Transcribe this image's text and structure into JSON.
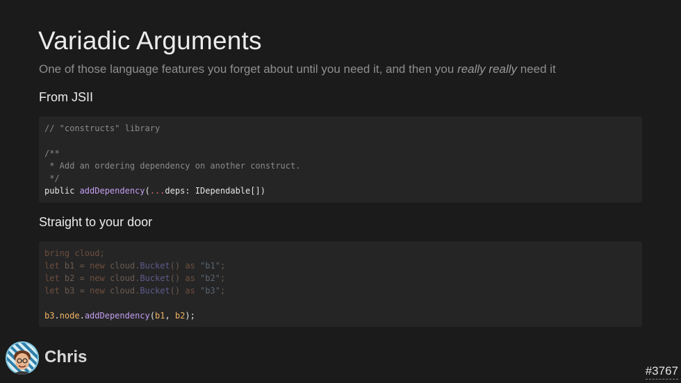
{
  "slide": {
    "title": "Variadic Arguments",
    "subtitle_prefix": "One of those language features you forget about until you need it, and then you ",
    "subtitle_emphasis": "really really",
    "subtitle_suffix": " need it"
  },
  "section1": {
    "heading": "From JSII",
    "code": {
      "line1": "// \"constructs\" library",
      "line3": "/**",
      "line4": " * Add an ordering dependency on another construct.",
      "line5": " */",
      "line6_public": "public ",
      "line6_fn": "addDependency",
      "line6_paren": "(",
      "line6_spread": "...",
      "line6_rest": "deps: IDependable[])"
    }
  },
  "section2": {
    "heading": "Straight to your door",
    "code": {
      "line1_kw": "bring",
      "line1_rest": " cloud;",
      "lines": [
        {
          "let": "let",
          "var": " b1 = ",
          "new": "new",
          "mod": " cloud.",
          "cls": "Bucket",
          "call": "() ",
          "as": "as",
          "str": " \"b1\"",
          "end": ";"
        },
        {
          "let": "let",
          "var": " b2 = ",
          "new": "new",
          "mod": " cloud.",
          "cls": "Bucket",
          "call": "() ",
          "as": "as",
          "str": " \"b2\"",
          "end": ";"
        },
        {
          "let": "let",
          "var": " b3 = ",
          "new": "new",
          "mod": " cloud.",
          "cls": "Bucket",
          "call": "() ",
          "as": "as",
          "str": " \"b3\"",
          "end": ";"
        }
      ],
      "last_obj": "b3",
      "last_dot1": ".",
      "last_node": "node",
      "last_dot2": ".",
      "last_fn": "addDependency",
      "last_open": "(",
      "last_arg1": "b1",
      "last_sep": ", ",
      "last_arg2": "b2",
      "last_close": ");"
    }
  },
  "footer": {
    "author": "Chris",
    "page_number": "#3767"
  }
}
